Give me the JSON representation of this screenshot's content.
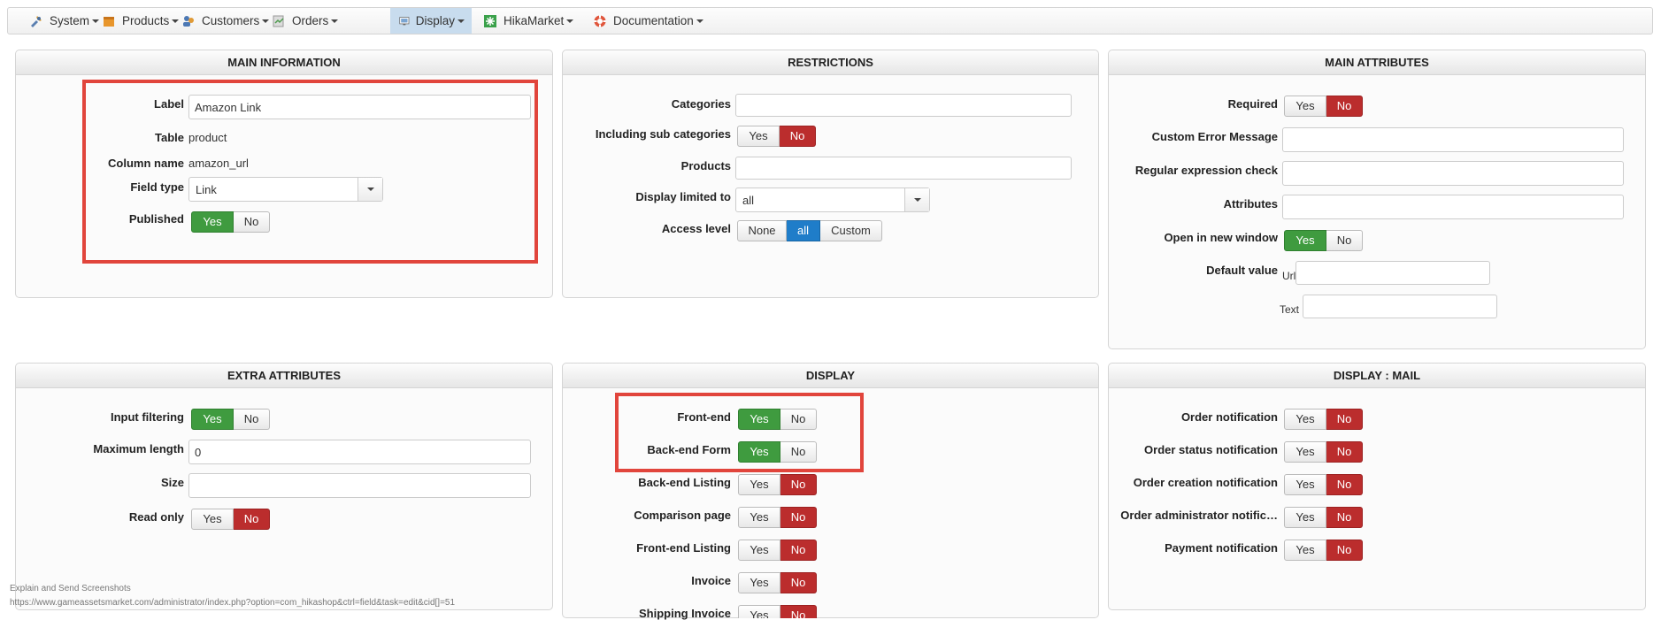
{
  "menu": {
    "system": "System",
    "products": "Products",
    "customers": "Customers",
    "orders": "Orders",
    "display": "Display",
    "hikamarket": "HikaMarket",
    "documentation": "Documentation"
  },
  "main_info": {
    "title": "MAIN INFORMATION",
    "label_label": "Label",
    "label_value": "Amazon Link",
    "table_label": "Table",
    "table_value": "product",
    "column_label": "Column name",
    "column_value": "amazon_url",
    "fieldtype_label": "Field type",
    "fieldtype_value": "Link",
    "published_label": "Published",
    "yes": "Yes",
    "no": "No"
  },
  "restrictions": {
    "title": "RESTRICTIONS",
    "categories_label": "Categories",
    "categories_value": "",
    "subcats_label": "Including sub categories",
    "products_label": "Products",
    "products_value": "",
    "display_limited_label": "Display limited to",
    "display_limited_value": "all",
    "access_label": "Access level",
    "access_none": "None",
    "access_all": "all",
    "access_custom": "Custom",
    "yes": "Yes",
    "no": "No"
  },
  "main_attributes": {
    "title": "MAIN ATTRIBUTES",
    "required_label": "Required",
    "custom_error_label": "Custom Error Message",
    "custom_error_value": "",
    "regex_label": "Regular expression check",
    "regex_value": "",
    "attributes_label": "Attributes",
    "attributes_value": "",
    "new_window_label": "Open in new window",
    "default_label": "Default value",
    "url_label": "Url",
    "url_value": "",
    "text_label": "Text",
    "text_value": "",
    "yes": "Yes",
    "no": "No"
  },
  "extra_attributes": {
    "title": "EXTRA ATTRIBUTES",
    "input_filtering_label": "Input filtering",
    "max_length_label": "Maximum length",
    "max_length_value": "0",
    "size_label": "Size",
    "size_value": "",
    "readonly_label": "Read only",
    "yes": "Yes",
    "no": "No"
  },
  "display": {
    "title": "DISPLAY",
    "frontend_label": "Front-end",
    "backend_form_label": "Back-end Form",
    "backend_listing_label": "Back-end Listing",
    "comparison_label": "Comparison page",
    "frontend_listing_label": "Front-end Listing",
    "invoice_label": "Invoice",
    "shipping_invoice_label": "Shipping Invoice",
    "yes": "Yes",
    "no": "No"
  },
  "display_mail": {
    "title": "DISPLAY : MAIL",
    "order_notification_label": "Order notification",
    "order_status_label": "Order status notification",
    "order_creation_label": "Order creation notification",
    "order_admin_label": "Order administrator notific…",
    "payment_label": "Payment notification",
    "yes": "Yes",
    "no": "No"
  },
  "footer": {
    "line1": "Explain and Send Screenshots",
    "line2": "https://www.gameassetsmarket.com/administrator/index.php?option=com_hikashop&ctrl=field&task=edit&cid[]=51"
  },
  "colors": {
    "yes_active": "#3f9b3f",
    "no_active": "#bb2d2d",
    "selected": "#1f7dc9",
    "highlight_box": "#e1453c"
  }
}
